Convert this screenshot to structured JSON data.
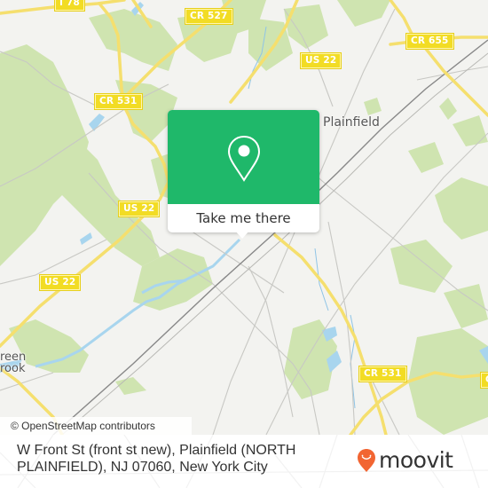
{
  "map": {
    "colors": {
      "background": "#f3f3f0",
      "park": "#cfe4b0",
      "water": "#a8d5ee",
      "road_major": "#f5df6e",
      "road_minor": "#c8c8c4",
      "rail": "#888888"
    },
    "road_labels": [
      {
        "id": "i78",
        "text": "I 78"
      },
      {
        "id": "cr527",
        "text": "CR 527"
      },
      {
        "id": "cr655",
        "text": "CR 655"
      },
      {
        "id": "us22-top",
        "text": "US 22"
      },
      {
        "id": "cr531-top",
        "text": "CR 531"
      },
      {
        "id": "us22-mid",
        "text": "US 22"
      },
      {
        "id": "us22-left",
        "text": "US 22"
      },
      {
        "id": "cr531-bottom",
        "text": "CR 531"
      },
      {
        "id": "cr-edge",
        "text": "C"
      }
    ],
    "place_labels": [
      {
        "id": "plainfield",
        "text": "Plainfield"
      },
      {
        "id": "green-brook-1",
        "text": "reen"
      },
      {
        "id": "green-brook-2",
        "text": "rook"
      }
    ]
  },
  "popup": {
    "accent": "#1fb86a",
    "icon": "map-pin-icon",
    "button_label": "Take me there"
  },
  "attribution": {
    "text": "© OpenStreetMap contributors"
  },
  "footer": {
    "address": "W Front St (front st new), Plainfield (NORTH PLAINFIELD), NJ 07060, New York City",
    "brand": {
      "name": "moovit",
      "color": "#f26532",
      "icon": "moovit-pin-icon"
    }
  }
}
